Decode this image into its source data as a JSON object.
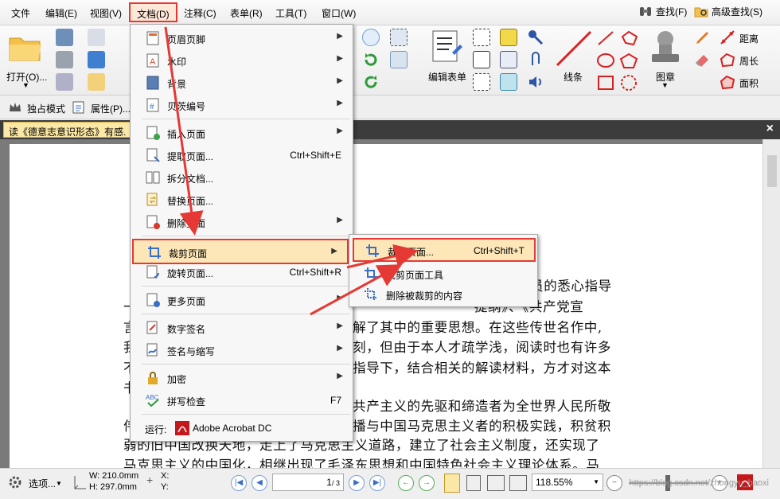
{
  "menubar": {
    "items": [
      "文件",
      "编辑(E)",
      "视图(V)",
      "文档(D)",
      "注释(C)",
      "表单(R)",
      "工具(T)",
      "窗口(W)"
    ],
    "find": "查找(F)",
    "advanced_find": "高级查找(S)"
  },
  "ribbon": {
    "open": "打开(O)...",
    "edit_form": "编辑表单",
    "line": "线条",
    "stamp": "图章",
    "distance": "距离",
    "perimeter": "周长",
    "area": "面积"
  },
  "toolbar2": {
    "exclusive_mode": "独占模式",
    "properties": "属性(P)..."
  },
  "tab": {
    "title": "读《德意志意识形态》有感.",
    "close": "×"
  },
  "document": {
    "lines": [
      "教员的悉心指导",
      "提纲》、《共产党宣",
      "了解了其中的重要思想。在这些传世名作中,",
      "深刻，但由于本人才疏学浅，阅读时也有许多",
      "解指导下，结合相关的解读材料，方才对这本",
      "为共产主义的先驱和缔造者为全世界人民所敬",
      "传播与中国马克思主义者的积极实践，积贫积",
      "弱的旧中国改换天地，走上了马克思主义道路，建立了社会主义制度，还实现了",
      "马克思主义的中国化，相继出现了毛泽东思想和中国特色社会主义理论体系。马"
    ],
    "left_fragments": [
      "一",
      "言",
      "我",
      "不",
      "书",
      "伟"
    ]
  },
  "menu": {
    "items": [
      {
        "label": "页眉页脚",
        "shortcut": "",
        "submenu": true
      },
      {
        "label": "水印",
        "shortcut": "",
        "submenu": true
      },
      {
        "label": "背景",
        "shortcut": "",
        "submenu": true
      },
      {
        "label": "贝茨编号",
        "shortcut": "",
        "submenu": true
      },
      {
        "label": "插入页面",
        "shortcut": "",
        "submenu": true
      },
      {
        "label": "提取页面...",
        "shortcut": "Ctrl+Shift+E",
        "submenu": false
      },
      {
        "label": "拆分文档...",
        "shortcut": "",
        "submenu": false
      },
      {
        "label": "替换页面...",
        "shortcut": "",
        "submenu": false
      },
      {
        "label": "删除页面",
        "shortcut": "",
        "submenu": true
      },
      {
        "label": "裁剪页面",
        "shortcut": "",
        "submenu": true
      },
      {
        "label": "旋转页面...",
        "shortcut": "Ctrl+Shift+R",
        "submenu": false
      },
      {
        "label": "更多页面",
        "shortcut": "",
        "submenu": true
      },
      {
        "label": "数字签名",
        "shortcut": "",
        "submenu": true
      },
      {
        "label": "签名与缩写",
        "shortcut": "",
        "submenu": true
      },
      {
        "label": "加密",
        "shortcut": "",
        "submenu": true
      },
      {
        "label": "拼写检查",
        "shortcut": "F7",
        "submenu": false
      }
    ],
    "run_label": "运行:",
    "run_app": "Adobe Acrobat DC"
  },
  "submenu": {
    "items": [
      {
        "label": "裁剪页面...",
        "shortcut": "Ctrl+Shift+T"
      },
      {
        "label": "裁剪页面工具",
        "shortcut": ""
      },
      {
        "label": "删除被裁剪的内容",
        "shortcut": ""
      }
    ]
  },
  "status": {
    "options": "选项...",
    "width": "W: 210.0mm",
    "height": "H: 297.0mm",
    "x": "X:",
    "y": "Y:",
    "page": "1",
    "page_total": "/ 3",
    "zoom": "118.55%",
    "watermark": "https://blog.csdn.net/zhongyu_baoxi"
  },
  "colors": {
    "highlight_border": "#e53935",
    "highlight_fill": "#fde7b8",
    "accent_blue": "#3a6fc8"
  }
}
